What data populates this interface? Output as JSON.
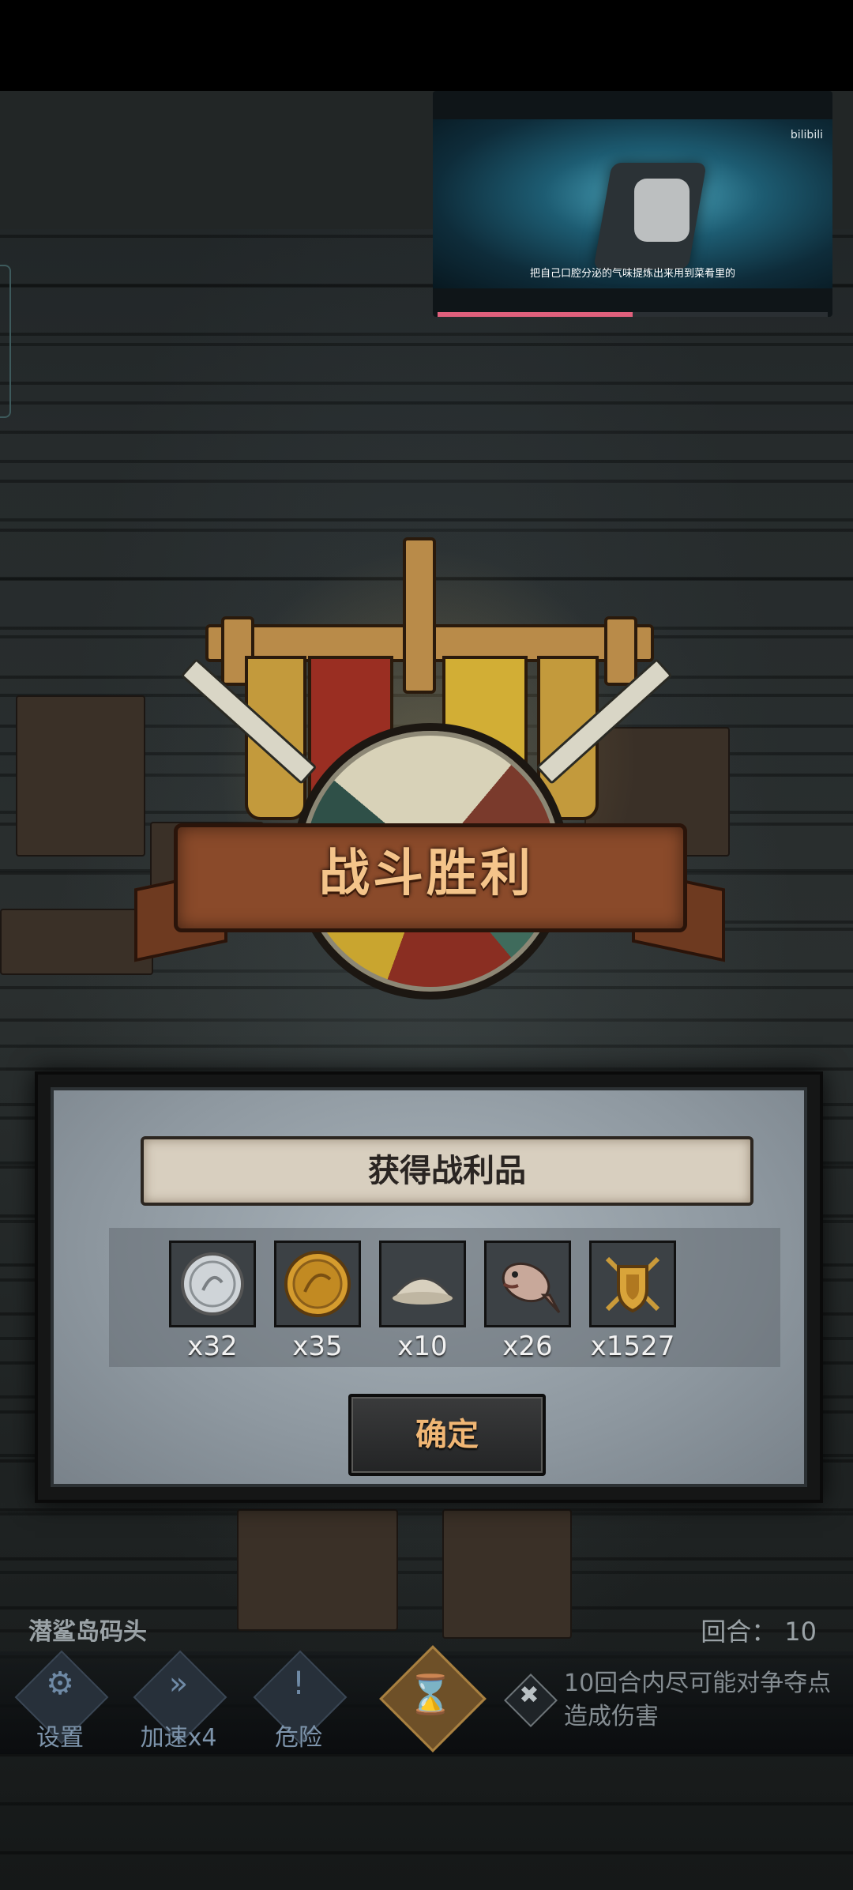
{
  "video_overlay": {
    "logo": "bilibili",
    "subtitle": "把自己口腔分泌的气味提炼出来用到菜肴里的",
    "progress_percent": 50
  },
  "battle_result": {
    "title": "战斗胜利"
  },
  "rewards_dialog": {
    "title": "获得战利品",
    "items": [
      {
        "icon": "silver-coin-icon",
        "count": "x32"
      },
      {
        "icon": "gold-coin-icon",
        "count": "x35"
      },
      {
        "icon": "flour-pile-icon",
        "count": "x10"
      },
      {
        "icon": "fish-icon",
        "count": "x26"
      },
      {
        "icon": "golden-shield-crest-icon",
        "count": "x1527"
      }
    ],
    "confirm_label": "确定"
  },
  "hud": {
    "location": "潜鲨岛码头",
    "round_label": "回合：",
    "round_value": "10",
    "buttons": {
      "settings": "设置",
      "speed": "加速x4",
      "danger": "危险"
    },
    "hint": "10回合内尽可能对争夺点造成伤害"
  },
  "colors": {
    "victory_text": "#f4c48a",
    "confirm_text": "#f0b674",
    "video_progress": "#e0607c"
  }
}
